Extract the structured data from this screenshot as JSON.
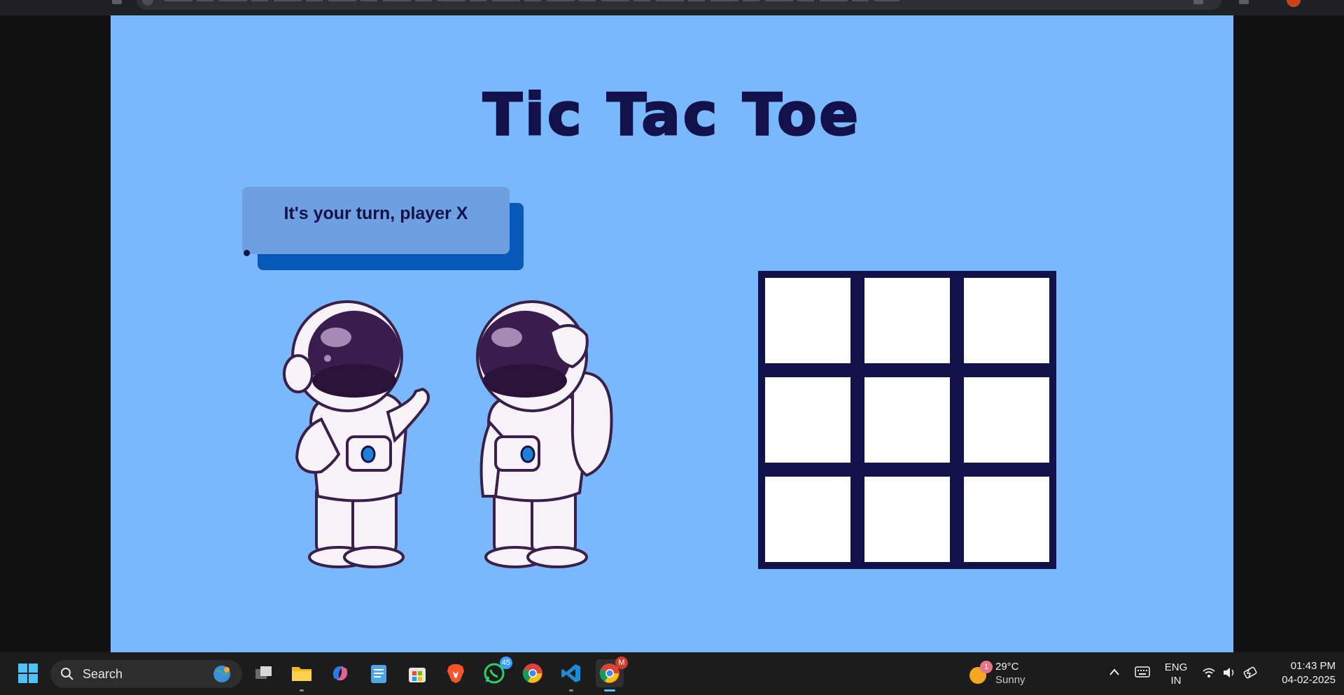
{
  "game": {
    "title": "Tic Tac Toe",
    "status_message": "It's your turn, player X",
    "board": [
      "",
      "",
      "",
      "",
      "",
      "",
      "",
      "",
      ""
    ]
  },
  "taskbar": {
    "search_label": "Search",
    "apps": [
      {
        "name": "file-explorer-icon"
      },
      {
        "name": "copilot-icon"
      },
      {
        "name": "notepad-icon"
      },
      {
        "name": "microsoft-store-icon"
      },
      {
        "name": "brave-icon"
      },
      {
        "name": "whatsapp-icon",
        "badge": "45"
      },
      {
        "name": "chrome-icon"
      },
      {
        "name": "vscode-icon"
      },
      {
        "name": "chrome-profile-icon",
        "badge": "M"
      }
    ],
    "weather": {
      "temperature": "29°C",
      "condition": "Sunny",
      "badge": "1"
    },
    "language": {
      "line1": "ENG",
      "line2": "IN"
    },
    "clock": {
      "time": "01:43 PM",
      "date": "04-02-2025"
    }
  },
  "colors": {
    "page_background": "#7ab8fd",
    "title": "#13114a",
    "board": "#13114a",
    "bubble": "#6e9fe0",
    "bubble_shadow": "#0759b8"
  }
}
